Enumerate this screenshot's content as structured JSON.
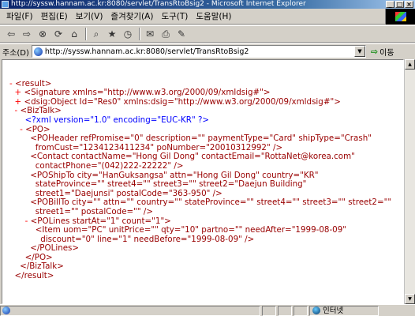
{
  "window": {
    "title": "http://syssw.hannam.ac.kr:8080/servlet/TransRtoBsig2 - Microsoft Internet Explorer",
    "btn_min": "_",
    "btn_max": "□",
    "btn_close": "×"
  },
  "menu": {
    "items": [
      "파일(F)",
      "편집(E)",
      "보기(V)",
      "즐겨찾기(A)",
      "도구(T)",
      "도움말(H)"
    ]
  },
  "toolbar": {
    "icons": [
      "back-icon",
      "forward-icon",
      "stop-icon",
      "refresh-icon",
      "home-icon",
      "search-icon",
      "favorites-icon",
      "history-icon",
      "mail-icon",
      "print-icon",
      "edit-icon"
    ]
  },
  "address": {
    "label": "주소(D)",
    "url": "http://syssw.hannam.ac.kr:8080/servlet/TransRtoBsig2",
    "go_label": "이동"
  },
  "xml": {
    "root_open": "<result>",
    "sig": "<Signature xmlns=\"http://www.w3.org/2000/09/xmldsig#\">",
    "obj": "<dsig:Object Id=\"Res0\" xmlns:dsig=\"http://www.w3.org/2000/09/xmldsig#\">",
    "biztalk_open": "<BizTalk>",
    "pi": "<?xml version=\"1.0\" encoding=\"EUC-KR\" ?>",
    "po_open": "<PO>",
    "poheader_1": "<POHeader refPromise=\"0\" description=\"\" paymentType=\"Card\" shipType=\"Crash\"",
    "poheader_2": "fromCust=\"1234123411234\" poNumber=\"20010312992\" />",
    "contact_1": "<Contact contactName=\"Hong Gil Dong\" contactEmail=\"RottaNet@korea.com\"",
    "contact_2": "contactPhone=\"(042)222-22222\" />",
    "shipto_1": "<POShipTo city=\"HanGuksangsa\" attn=\"Hong Gil Dong\" country=\"KR\"",
    "shipto_2": "stateProvince=\"\" street4=\"\" street3=\"\" street2=\"Daejun Building\"",
    "shipto_3": "street1=\"Daejunsi\" postalCode=\"363-950\" />",
    "billto_1": "<POBillTo city=\"\" attn=\"\" country=\"\" stateProvince=\"\" street4=\"\" street3=\"\" street2=\"\"",
    "billto_2": "street1=\"\" postalCode=\"\" />",
    "polines_open": "<POLines startAt=\"1\" count=\"1\">",
    "item_1": "<Item uom=\"PC\" unitPrice=\"\" qty=\"10\" partno=\"\" needAfter=\"1999-08-09\"",
    "item_2": "discount=\"0\" line=\"1\" needBefore=\"1999-08-09\" />",
    "polines_close": "</POLines>",
    "po_close": "</PO>",
    "biztalk_close": "</BizTalk>",
    "root_close": "</result>",
    "minus": "-",
    "plus": "+"
  },
  "status": {
    "zone": "인터넷"
  }
}
